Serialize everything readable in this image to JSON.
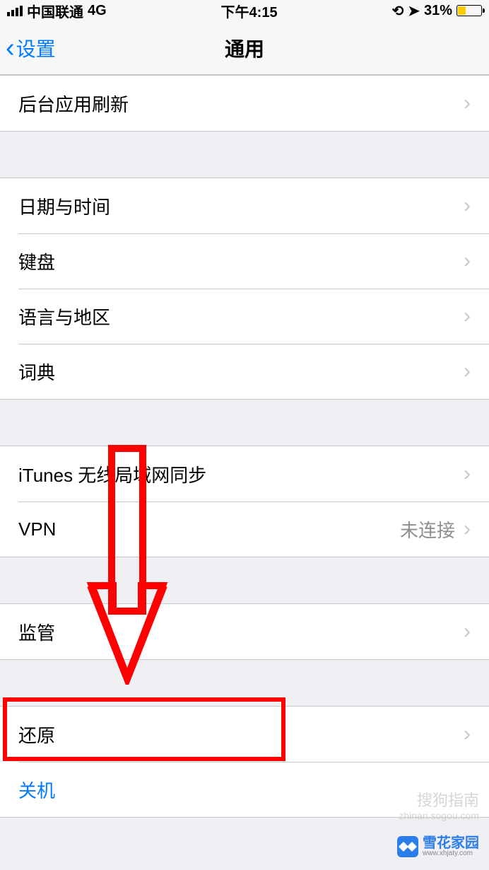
{
  "status": {
    "carrier": "中国联通",
    "network": "4G",
    "time": "下午4:15",
    "lock": "🔒",
    "location": "➤",
    "battery_pct": "31%"
  },
  "nav": {
    "back": "设置",
    "title": "通用"
  },
  "rows": {
    "bg_refresh": "后台应用刷新",
    "date_time": "日期与时间",
    "keyboard": "键盘",
    "lang_region": "语言与地区",
    "dictionary": "词典",
    "itunes_wifi": "iTunes 无线局域网同步",
    "vpn": "VPN",
    "vpn_status": "未连接",
    "regulatory": "监管",
    "reset": "还原",
    "shutdown": "关机"
  },
  "watermarks": {
    "sogou": "搜狗指南",
    "sogou_url": "zhinan.sogou.com",
    "xuehua": "雪花家园",
    "xuehua_url": "www.xhjaty.com"
  }
}
